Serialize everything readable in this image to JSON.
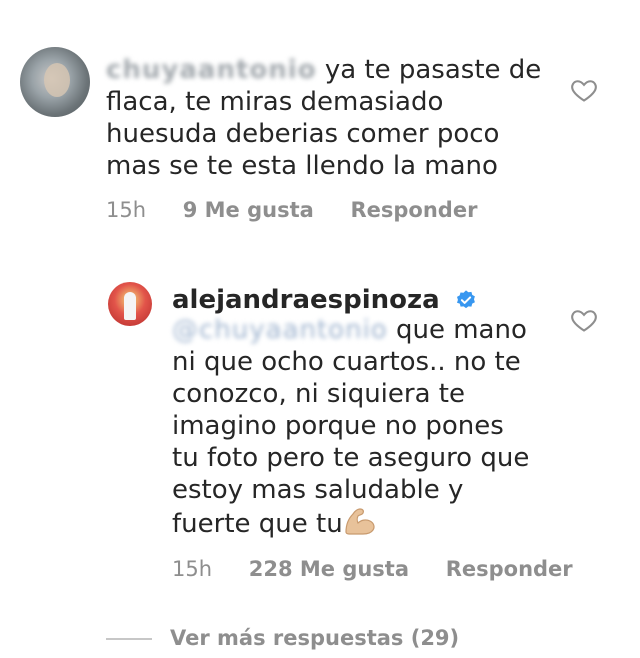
{
  "comments": [
    {
      "username": "chuyaantonio",
      "text_lines": [
        "ya te pasaste de",
        "flaca, te miras demasiado",
        "huesuda deberias comer poco",
        "mas se te esta llendo la mano"
      ],
      "time": "15h",
      "likes": "9 Me gusta",
      "reply": "Responder"
    },
    {
      "username": "alejandraespinoza",
      "verified": true,
      "mention": "@chuyaantonio",
      "text_lines": [
        "que mano",
        "ni que ocho cuartos.. no te",
        "conozco, ni siquiera te",
        "imagino porque no pones",
        "tu foto pero te aseguro que",
        "estoy mas saludable y",
        "fuerte que tu"
      ],
      "emoji": "flexed-biceps",
      "time": "15h",
      "likes": "228 Me gusta",
      "reply": "Responder"
    }
  ],
  "view_more": "Ver más respuestas (29)",
  "colors": {
    "text": "#262626",
    "muted": "#8e8e8e",
    "verified": "#3897f0",
    "mention": "#9fb4cf"
  }
}
